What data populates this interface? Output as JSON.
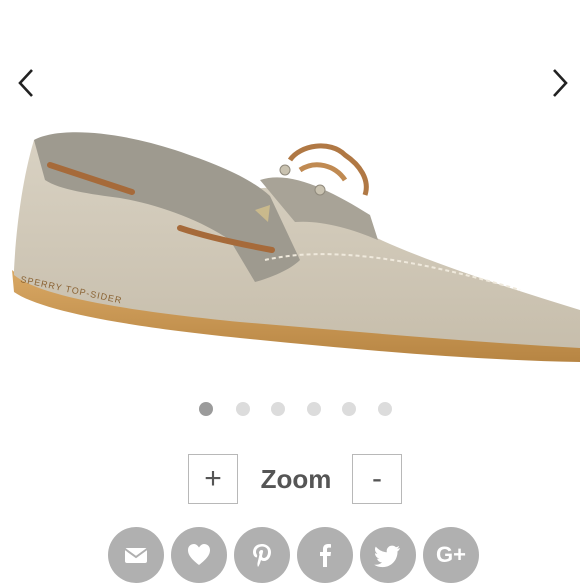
{
  "gallery": {
    "prev_icon": "chevron-left-icon",
    "next_icon": "chevron-right-icon",
    "image": "boat-shoe-product-photo",
    "brand_imprint": "SPERRY TOP-SIDER",
    "dots_total": 6,
    "active_dot": 1
  },
  "zoom": {
    "plus_label": "+",
    "label": "Zoom",
    "minus_label": "-"
  },
  "share": {
    "icons": [
      "email-icon",
      "heart-icon",
      "pinterest-icon",
      "facebook-icon",
      "twitter-icon",
      "google-plus-icon"
    ],
    "google_plus_text": "G+"
  },
  "colors": {
    "dot_active": "#9b9b9b",
    "dot_inactive": "#dcdcdc",
    "share_bg": "#b0b0b0"
  }
}
